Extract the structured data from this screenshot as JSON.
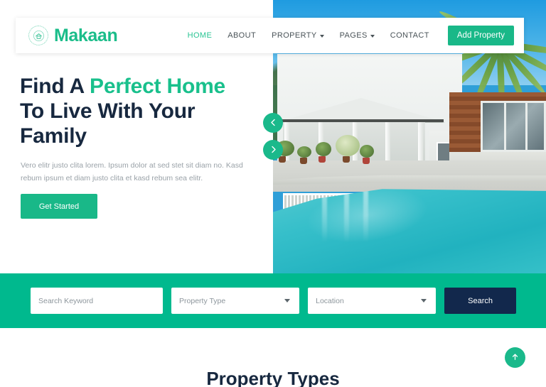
{
  "brand": {
    "name": "Makaan",
    "logo_icon": "house-badge-icon"
  },
  "nav": {
    "items": [
      {
        "label": "HOME",
        "active": true,
        "has_dropdown": false
      },
      {
        "label": "ABOUT",
        "active": false,
        "has_dropdown": false
      },
      {
        "label": "PROPERTY",
        "active": false,
        "has_dropdown": true
      },
      {
        "label": "PAGES",
        "active": false,
        "has_dropdown": true
      },
      {
        "label": "CONTACT",
        "active": false,
        "has_dropdown": false
      }
    ],
    "cta_label": "Add Property"
  },
  "hero": {
    "title_line1_plain": "Find A ",
    "title_line1_accent": "Perfect Home",
    "title_line2": "To Live With Your",
    "title_line3": "Family",
    "description": "Vero elitr justo clita lorem. Ipsum dolor at sed stet sit diam no. Kasd rebum ipsum et diam justo clita et kasd rebum sea elitr.",
    "cta_label": "Get Started",
    "carousel": {
      "prev_icon": "chevron-left-icon",
      "next_icon": "chevron-right-icon"
    },
    "image_alt": "Two-story white house with swimming pool and palm trees"
  },
  "search": {
    "keyword_placeholder": "Search Keyword",
    "keyword_value": "",
    "property_type_label": "Property Type",
    "location_label": "Location",
    "button_label": "Search"
  },
  "sections": {
    "property_types_title": "Property Types"
  },
  "back_to_top": {
    "icon": "arrow-up-icon"
  },
  "colors": {
    "primary_green": "#00B98E",
    "brand_green": "#19B888",
    "accent_green": "#19C08C",
    "dark_navy": "#17283F",
    "search_button_navy": "#12284C",
    "muted_text": "#9AA2A8"
  }
}
